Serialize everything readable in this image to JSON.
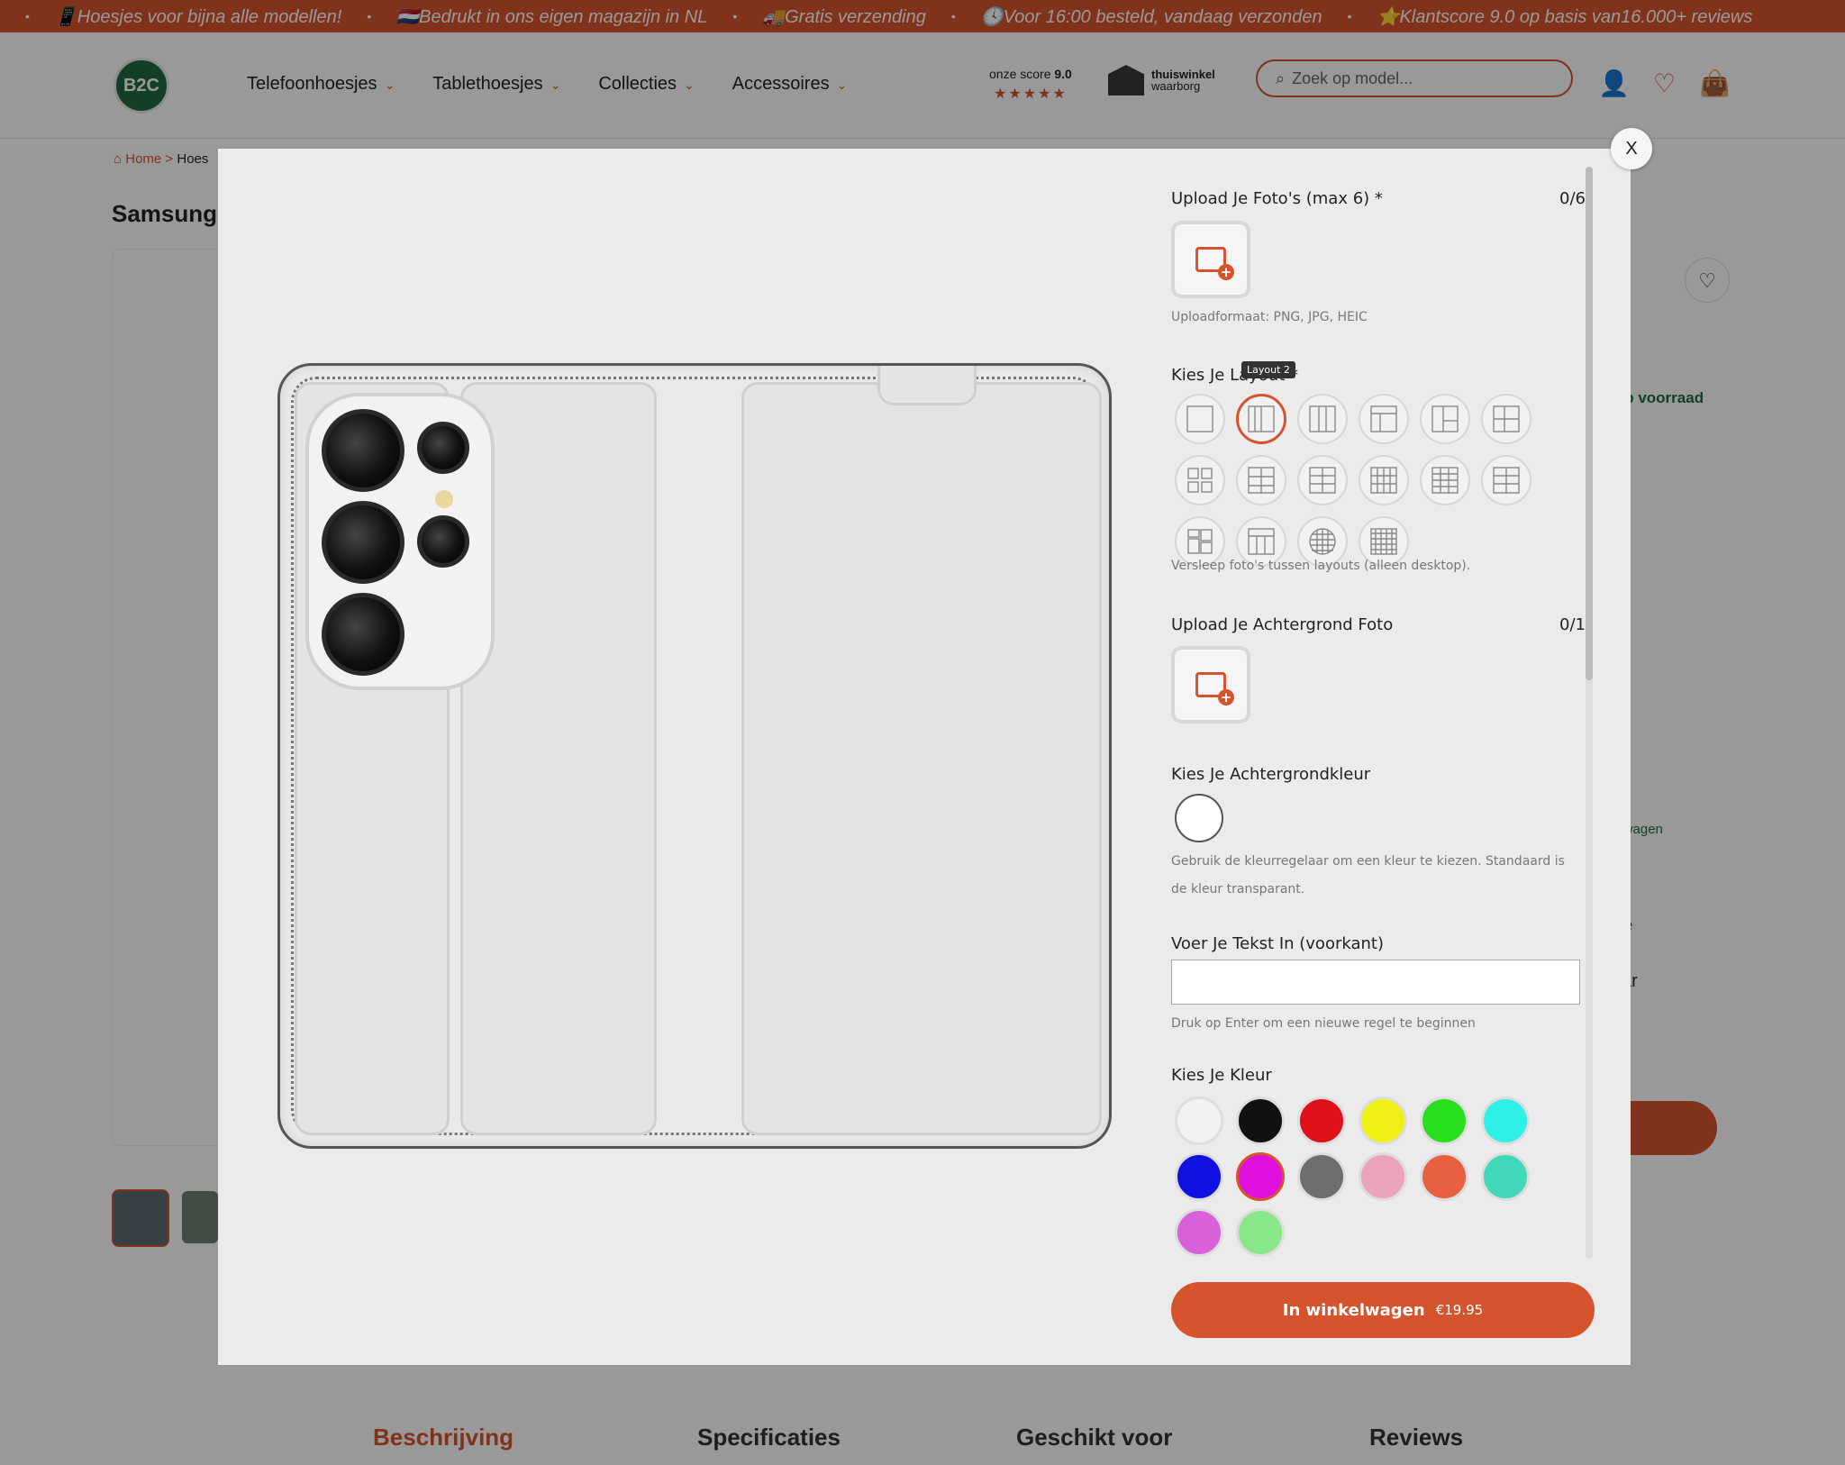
{
  "announcements": [
    "📱Hoesjes voor bijna alle modellen!",
    "🇳🇱Bedrukt in ons eigen magazijn in NL",
    "🚚Gratis verzending",
    "🕓Voor 16:00 besteld, vandaag verzonden",
    "⭐Klantscore 9.0 op basis van16.000+ reviews"
  ],
  "header": {
    "logo": "B2C",
    "nav": [
      "Telefoonhoesjes",
      "Tablethoesjes",
      "Collecties",
      "Accessoires"
    ],
    "score_label": "onze score",
    "score_value": "9.0",
    "rating": 4.5,
    "thuiswinkel_1": "thuiswinkel",
    "thuiswinkel_2": "waarborg",
    "search_placeholder": "Zoek op model..."
  },
  "breadcrumb": {
    "home": "Home",
    "sep": ">",
    "current": "Hoes"
  },
  "product_title": "Samsung G",
  "background_right": {
    "stock": "Op voorraad",
    "cart_note": "elwagen",
    "frag1": "oe",
    "frag2": "kar"
  },
  "tabs": [
    "Beschrijving",
    "Specificaties",
    "Geschikt voor",
    "Reviews"
  ],
  "modal": {
    "close": "X",
    "upload_title": "Upload Je Foto's (max 6) *",
    "upload_count": "0/6",
    "upload_format": "Uploadformaat: PNG, JPG, HEIC",
    "layout_title": "Kies Je Layout *",
    "tooltip": "Layout 2",
    "layout_hint": "Versleep foto's tussen layouts (alleen desktop).",
    "bg_upload_title": "Upload Je Achtergrond Foto",
    "bg_upload_count": "0/1",
    "bg_color_title": "Kies Je Achtergrondkleur",
    "bg_color_hint": "Gebruik de kleurregelaar om een kleur te kiezen. Standaard is de kleur transparant.",
    "text_title": "Voer Je Tekst In (voorkant)",
    "text_value": "",
    "text_hint": "Druk op Enter om een nieuwe regel te beginnen",
    "color_title": "Kies Je Kleur",
    "colors": [
      "#f2f2f2",
      "#111111",
      "#e0101a",
      "#eef016",
      "#28e01e",
      "#2ef0e6",
      "#1010e0",
      "#e010e0",
      "#6e6e6e",
      "#eaa3b8",
      "#e86040",
      "#40d8b8",
      "#d860d8",
      "#88e888"
    ],
    "selected_color_index": 7,
    "cart_label": "In winkelwagen",
    "cart_price": "€19.95"
  }
}
